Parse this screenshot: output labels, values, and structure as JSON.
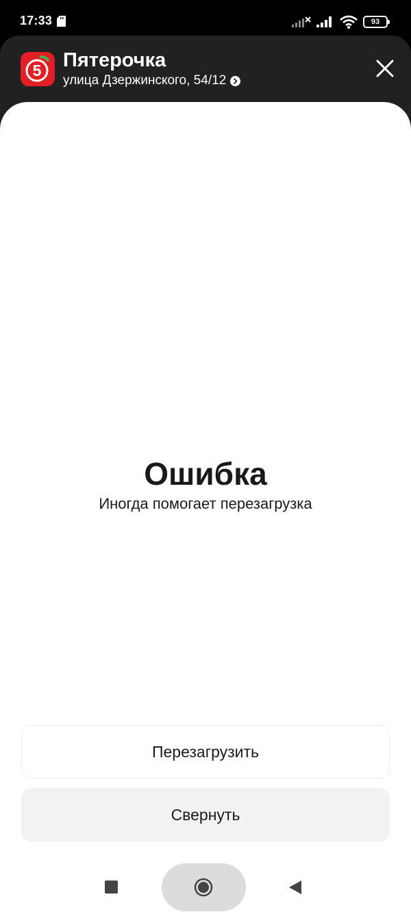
{
  "status_bar": {
    "time": "17:33",
    "battery_level": "93",
    "icons": [
      "sd-card-icon",
      "signal-no-service-icon",
      "signal-bars-icon",
      "wifi-icon",
      "battery-icon"
    ]
  },
  "header": {
    "store_name": "Пятерочка",
    "store_address": "улица Дзержинского, 54/12",
    "logo_icon": "pyaterochka-logo-icon",
    "brand_color": "#e31e24"
  },
  "error": {
    "title": "Ошибка",
    "subtitle": "Иногда помогает перезагрузка"
  },
  "buttons": {
    "reload_label": "Перезагрузить",
    "collapse_label": "Свернуть"
  },
  "nav_bar": {
    "icons": [
      "recent-apps-icon",
      "home-icon",
      "back-icon"
    ]
  }
}
